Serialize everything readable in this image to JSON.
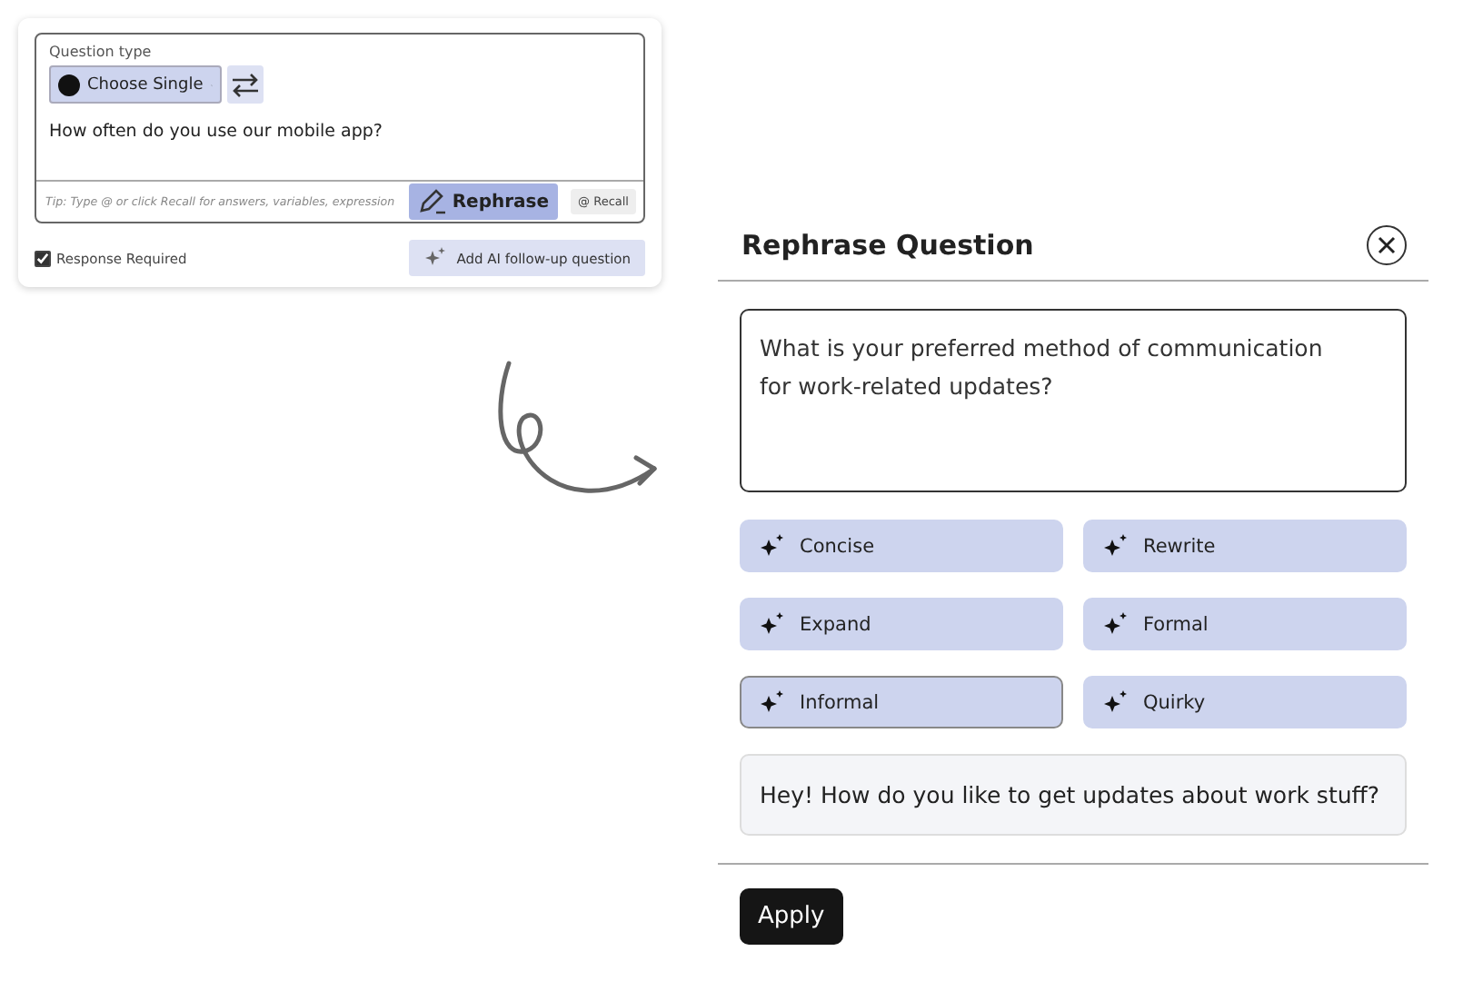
{
  "editor": {
    "question_type_label": "Question type",
    "type_select": {
      "value": "Choose Single"
    },
    "question": "How often do you use our mobile app?",
    "tip": "Tip: Type @ or click Recall for answers, variables, expression",
    "rephrase_button": "Rephrase",
    "recall_button": "Recall",
    "recall_symbol": "@",
    "response_required": {
      "label": "Response Required",
      "checked": true
    },
    "ai_followup_button": "Add AI follow-up question"
  },
  "dialog": {
    "title": "Rephrase Question",
    "question_text": "What is your preferred method of communication\nfor work-related updates?",
    "options": [
      {
        "label": "Concise",
        "selected": false
      },
      {
        "label": "Rewrite",
        "selected": false
      },
      {
        "label": "Expand",
        "selected": false
      },
      {
        "label": "Formal",
        "selected": false
      },
      {
        "label": "Informal",
        "selected": true
      },
      {
        "label": "Quirky",
        "selected": false
      }
    ],
    "result": "Hey! How do you like to get updates about work stuff?",
    "apply_button": "Apply"
  }
}
